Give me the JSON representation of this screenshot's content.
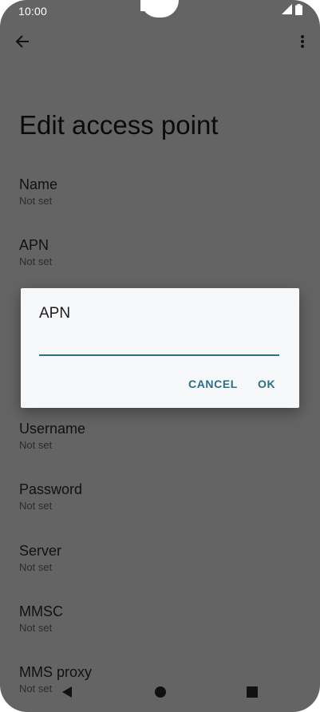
{
  "status_bar": {
    "time": "10:00"
  },
  "page": {
    "title": "Edit access point"
  },
  "list_items": [
    {
      "title": "Name",
      "summary": "Not set"
    },
    {
      "title": "APN",
      "summary": "Not set"
    },
    {
      "title": "Username",
      "summary": "Not set"
    },
    {
      "title": "Password",
      "summary": "Not set"
    },
    {
      "title": "Server",
      "summary": "Not set"
    },
    {
      "title": "MMSC",
      "summary": "Not set"
    },
    {
      "title": "MMS proxy",
      "summary": "Not set"
    }
  ],
  "dialog": {
    "title": "APN",
    "input_value": "",
    "cancel_label": "CANCEL",
    "ok_label": "OK"
  },
  "colors": {
    "accent": "#2b6f85",
    "scrim": "#646464",
    "dialog_bg": "#f6f8fa"
  }
}
